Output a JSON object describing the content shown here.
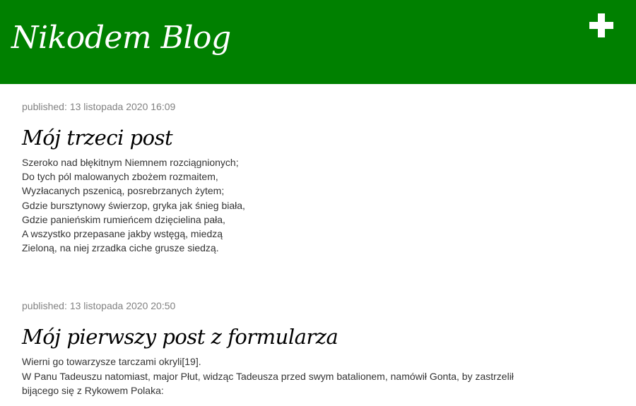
{
  "header": {
    "title": "Nikodem Blog",
    "add_icon": "plus-icon",
    "background_color": "#008000"
  },
  "posts": [
    {
      "published_label": "published:",
      "date": "13 listopada 2020 16:09",
      "title": "Mój trzeci post",
      "text": "Szeroko nad błękitnym Niemnem rozciągnionych;\nDo tych pól malowanych zbożem rozmaitem,\nWyzłacanych pszenicą, posrebrzanych żytem;\nGdzie bursztynowy świerzop, gryka jak śnieg biała,\nGdzie panieńskim rumieńcem dzięcielina pała,\nA wszystko przepasane jakby wstęgą, miedzą\nZieloną, na niej zrzadka ciche grusze siedzą."
    },
    {
      "published_label": "published:",
      "date": "13 listopada 2020 20:50",
      "title": "Mój pierwszy post z formularza",
      "text": "Wierni go towarzysze tarczami okryli[19].\nW Panu Tadeuszu natomiast, major Płut, widząc Tadeusza przed swym batalionem, namówił Gonta, by zastrzelił bijącego się z Rykowem Polaka:"
    }
  ]
}
